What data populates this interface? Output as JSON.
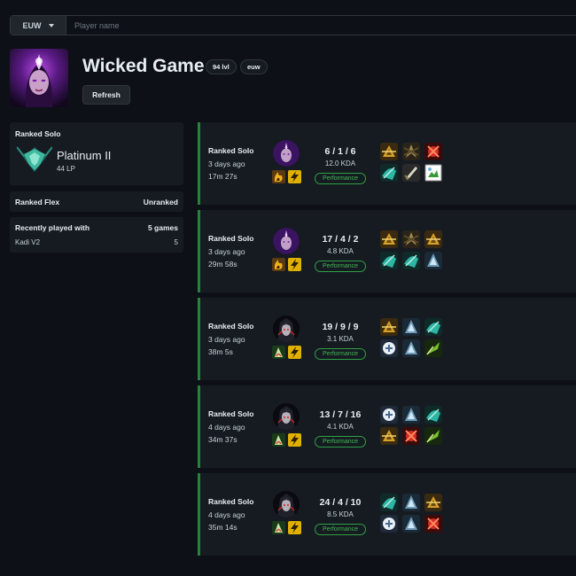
{
  "search": {
    "region": "EUW",
    "placeholder": "Player name",
    "value": ""
  },
  "profile": {
    "name": "Wicked Game",
    "level_badge": "94 lvl",
    "region_badge": "euw",
    "refresh_label": "Refresh"
  },
  "ranked_solo": {
    "title": "Ranked Solo",
    "tier": "Platinum II",
    "lp": "44 LP"
  },
  "ranked_flex": {
    "title": "Ranked Flex",
    "status": "Unranked"
  },
  "recent": {
    "title": "Recently played with",
    "games": "5 games",
    "players": [
      {
        "name": "Kadi V2",
        "count": "5"
      }
    ]
  },
  "matches": [
    {
      "queue": "Ranked Solo",
      "ago": "3 days ago",
      "duration": "17m 27s",
      "kda": "6 / 1 / 6",
      "kda_ratio": "12.0 KDA",
      "performance": "Performance",
      "champion": "purple-mage",
      "spells": [
        "ignite",
        "flash"
      ],
      "items": [
        "gold",
        "dark",
        "red",
        "teal",
        "sword",
        "broken"
      ]
    },
    {
      "queue": "Ranked Solo",
      "ago": "3 days ago",
      "duration": "29m 58s",
      "kda": "17 / 4 / 2",
      "kda_ratio": "4.8 KDA",
      "performance": "Performance",
      "champion": "purple-mage",
      "spells": [
        "ignite",
        "flash"
      ],
      "items": [
        "gold",
        "dark",
        "gold",
        "teal",
        "teal",
        "silver"
      ]
    },
    {
      "queue": "Ranked Solo",
      "ago": "3 days ago",
      "duration": "38m 5s",
      "kda": "19 / 9 / 9",
      "kda_ratio": "3.1 KDA",
      "performance": "Performance",
      "champion": "dark-assassin",
      "spells": [
        "ghost",
        "flash"
      ],
      "items": [
        "gold",
        "silver",
        "teal",
        "white",
        "silver",
        "green"
      ]
    },
    {
      "queue": "Ranked Solo",
      "ago": "4 days ago",
      "duration": "34m 37s",
      "kda": "13 / 7 / 16",
      "kda_ratio": "4.1 KDA",
      "performance": "Performance",
      "champion": "dark-assassin",
      "spells": [
        "ghost",
        "flash"
      ],
      "items": [
        "white",
        "silver",
        "teal",
        "gold",
        "red",
        "green"
      ]
    },
    {
      "queue": "Ranked Solo",
      "ago": "4 days ago",
      "duration": "35m 14s",
      "kda": "24 / 4 / 10",
      "kda_ratio": "8.5 KDA",
      "performance": "Performance",
      "champion": "dark-assassin",
      "spells": [
        "ghost",
        "flash"
      ],
      "items": [
        "teal",
        "silver",
        "gold",
        "white",
        "silver",
        "red"
      ]
    }
  ]
}
